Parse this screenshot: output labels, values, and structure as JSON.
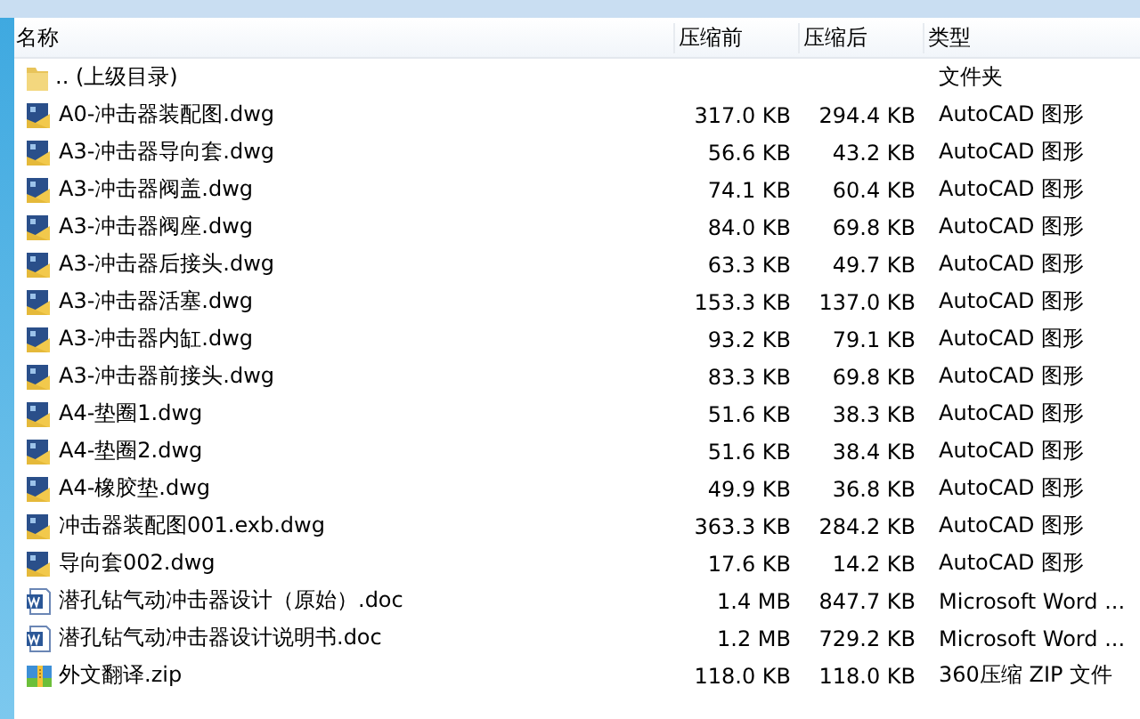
{
  "columns": [
    "名称",
    "压缩前",
    "压缩后",
    "类型"
  ],
  "rows": [
    {
      "kind": "folder",
      "name": ".. (上级目录)",
      "size_before": "",
      "size_after": "",
      "type": "文件夹"
    },
    {
      "kind": "dwg",
      "name": "A0-冲击器装配图.dwg",
      "size_before": "317.0 KB",
      "size_after": "294.4 KB",
      "type": "AutoCAD 图形"
    },
    {
      "kind": "dwg",
      "name": "A3-冲击器导向套.dwg",
      "size_before": "56.6 KB",
      "size_after": "43.2 KB",
      "type": "AutoCAD 图形"
    },
    {
      "kind": "dwg",
      "name": "A3-冲击器阀盖.dwg",
      "size_before": "74.1 KB",
      "size_after": "60.4 KB",
      "type": "AutoCAD 图形"
    },
    {
      "kind": "dwg",
      "name": "A3-冲击器阀座.dwg",
      "size_before": "84.0 KB",
      "size_after": "69.8 KB",
      "type": "AutoCAD 图形"
    },
    {
      "kind": "dwg",
      "name": "A3-冲击器后接头.dwg",
      "size_before": "63.3 KB",
      "size_after": "49.7 KB",
      "type": "AutoCAD 图形"
    },
    {
      "kind": "dwg",
      "name": "A3-冲击器活塞.dwg",
      "size_before": "153.3 KB",
      "size_after": "137.0 KB",
      "type": "AutoCAD 图形"
    },
    {
      "kind": "dwg",
      "name": "A3-冲击器内缸.dwg",
      "size_before": "93.2 KB",
      "size_after": "79.1 KB",
      "type": "AutoCAD 图形"
    },
    {
      "kind": "dwg",
      "name": "A3-冲击器前接头.dwg",
      "size_before": "83.3 KB",
      "size_after": "69.8 KB",
      "type": "AutoCAD 图形"
    },
    {
      "kind": "dwg",
      "name": "A4-垫圈1.dwg",
      "size_before": "51.6 KB",
      "size_after": "38.3 KB",
      "type": "AutoCAD 图形"
    },
    {
      "kind": "dwg",
      "name": "A4-垫圈2.dwg",
      "size_before": "51.6 KB",
      "size_after": "38.4 KB",
      "type": "AutoCAD 图形"
    },
    {
      "kind": "dwg",
      "name": "A4-橡胶垫.dwg",
      "size_before": "49.9 KB",
      "size_after": "36.8 KB",
      "type": "AutoCAD 图形"
    },
    {
      "kind": "dwg",
      "name": "冲击器装配图001.exb.dwg",
      "size_before": "363.3 KB",
      "size_after": "284.2 KB",
      "type": "AutoCAD 图形"
    },
    {
      "kind": "dwg",
      "name": "导向套002.dwg",
      "size_before": "17.6 KB",
      "size_after": "14.2 KB",
      "type": "AutoCAD 图形"
    },
    {
      "kind": "doc",
      "name": "潜孔钻气动冲击器设计（原始）.doc",
      "size_before": "1.4 MB",
      "size_after": "847.7 KB",
      "type": "Microsoft Word ..."
    },
    {
      "kind": "doc",
      "name": "潜孔钻气动冲击器设计说明书.doc",
      "size_before": "1.2 MB",
      "size_after": "729.2 KB",
      "type": "Microsoft Word ..."
    },
    {
      "kind": "zip",
      "name": "外文翻译.zip",
      "size_before": "118.0 KB",
      "size_after": "118.0 KB",
      "type": "360压缩 ZIP 文件"
    }
  ]
}
